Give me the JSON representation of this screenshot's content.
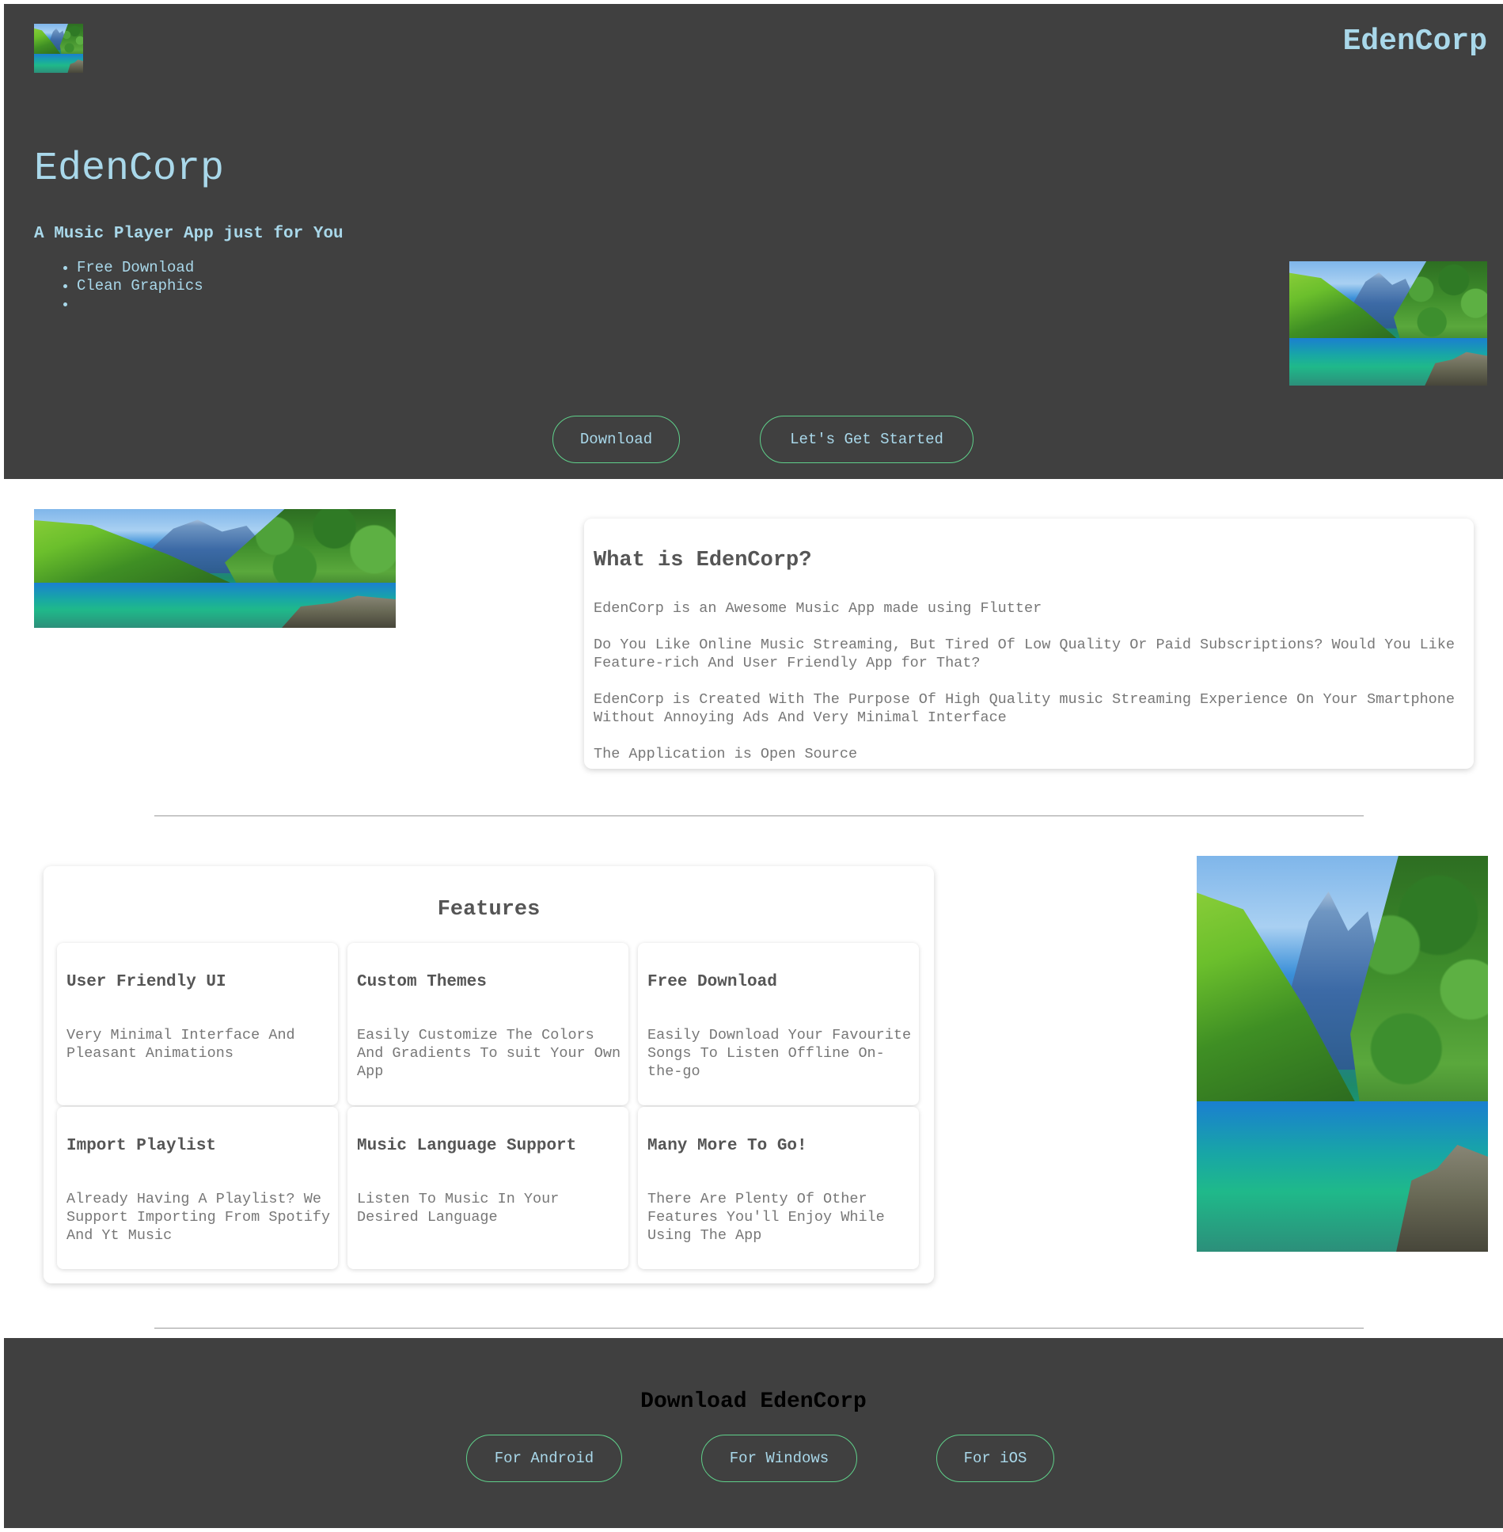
{
  "header": {
    "brand": "EdenCorp",
    "logo_icon": "landscape-image"
  },
  "hero": {
    "title": "EdenCorp",
    "subtitle": "A Music Player App just for You",
    "bullets": [
      "Free Download",
      "Clean Graphics",
      ""
    ],
    "buttons": {
      "download": "Download",
      "get_started": "Let's Get Started"
    }
  },
  "about": {
    "heading": "What is EdenCorp?",
    "paragraphs": [
      "EdenCorp is an Awesome Music App made using Flutter",
      "Do You Like Online Music Streaming, But Tired Of Low Quality Or Paid Subscriptions? Would You Like Feature-rich And User Friendly App for That?",
      "EdenCorp is Created With The Purpose Of High Quality music Streaming Experience On Your Smartphone Without Annoying Ads And Very Minimal Interface",
      "The Application is Open Source"
    ]
  },
  "features": {
    "heading": "Features",
    "items": [
      {
        "title": "User Friendly UI",
        "desc": "Very Minimal Interface And Pleasant Animations"
      },
      {
        "title": "Custom Themes",
        "desc": "Easily Customize The Colors And Gradients To suit Your Own App"
      },
      {
        "title": "Free Download",
        "desc": "Easily Download Your Favourite Songs To Listen Offline On-the-go"
      },
      {
        "title": "Import Playlist",
        "desc": "Already Having A Playlist? We Support Importing From Spotify And Yt Music"
      },
      {
        "title": "Music Language Support",
        "desc": "Listen To Music In Your Desired Language"
      },
      {
        "title": "Many More To Go!",
        "desc": "There Are Plenty Of Other Features You'll Enjoy While Using The App"
      }
    ]
  },
  "download": {
    "heading": "Download EdenCorp",
    "android": "For Android",
    "windows": "For Windows",
    "ios": "For iOS"
  },
  "colors": {
    "dark_bg": "#404040",
    "accent_text": "#a9d8ea",
    "button_border": "#5fd08a",
    "heading_gray": "#555555",
    "body_gray": "#777777"
  }
}
